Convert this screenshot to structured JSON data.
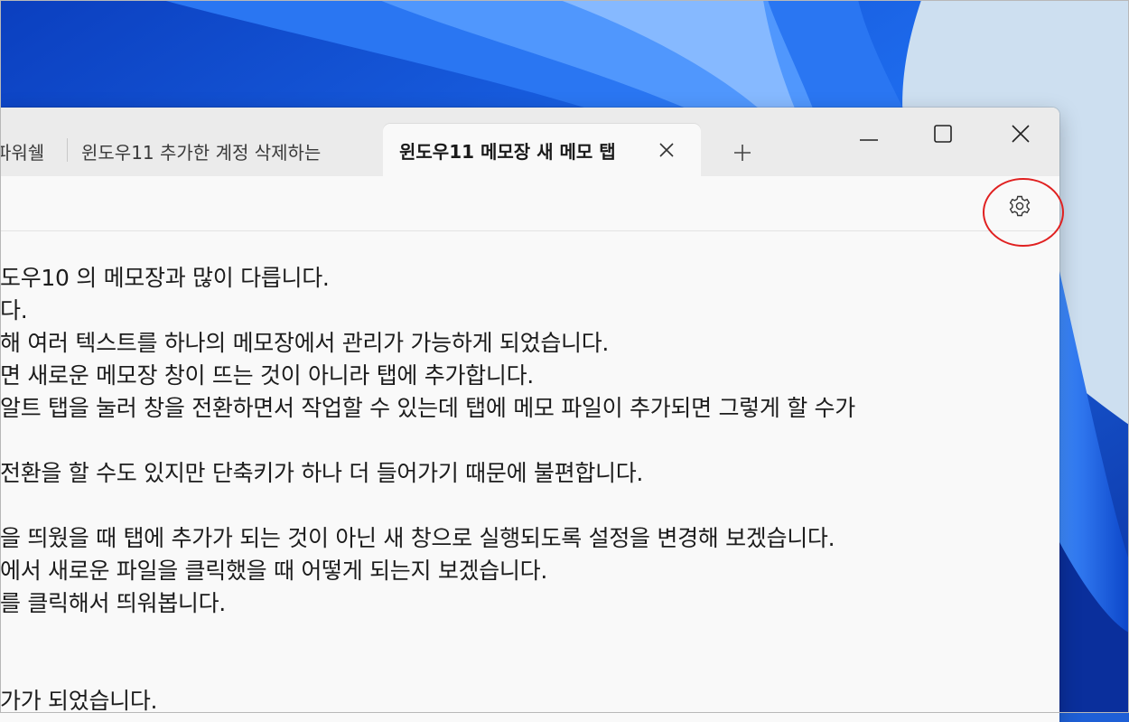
{
  "window": {
    "tabs": [
      {
        "label": "파워쉘",
        "active": false
      },
      {
        "label": "윈도우11 추가한 계정 삭제하는",
        "active": false
      },
      {
        "label": "윈도우11 메모장 새 메모 탭",
        "active": true
      }
    ],
    "controls": {
      "tab_close_icon": "close-icon",
      "new_tab_icon": "plus-icon",
      "minimize_icon": "minimize-icon",
      "maximize_icon": "maximize-icon",
      "close_icon": "close-icon"
    }
  },
  "toolbar": {
    "settings_icon": "gear-icon",
    "highlight_color": "#e02020"
  },
  "editor": {
    "lines": [
      "도우10 의 메모장과 많이 다릅니다.",
      "다.",
      "해 여러 텍스트를 하나의 메모장에서 관리가 가능하게 되었습니다.",
      "면 새로운 메모장 창이 뜨는 것이 아니라 탭에 추가합니다.",
      "알트 탭을 눌러 창을 전환하면서 작업할 수 있는데 탭에 메모 파일이 추가되면 그렇게 할 수가",
      "",
      " 전환을 할 수도 있지만 단축키가 하나 더 들어가기 때문에 불편합니다.",
      "",
      "을 띄웠을 때 탭에 추가가 되는 것이 아닌 새 창으로 실행되도록 설정을 변경해 보겠습니다.",
      "에서 새로운 파일을 클릭했을 때 어떻게 되는지 보겠습니다.",
      "를 클릭해서 띄워봅니다.",
      "",
      "",
      "가가 되었습니다."
    ]
  },
  "colors": {
    "tab_strip": "#ebebeb",
    "editor_bg": "#f9f9f9",
    "text": "#1c1c1c"
  }
}
